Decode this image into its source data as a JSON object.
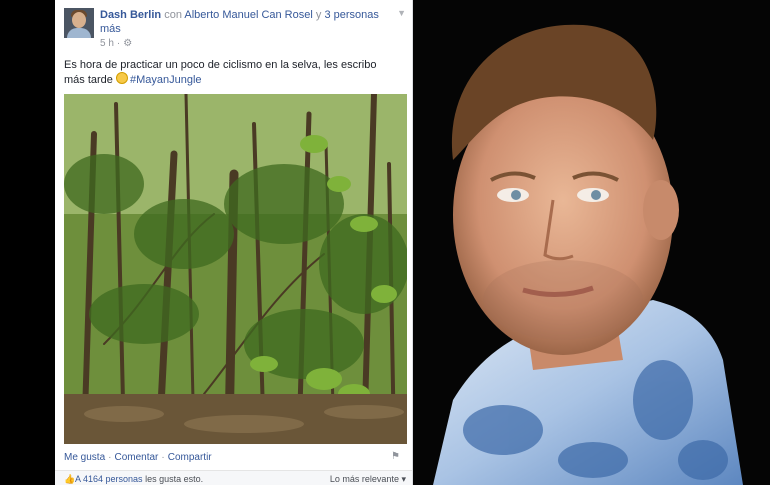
{
  "post": {
    "author": "Dash Berlin",
    "with_word": "con",
    "tagged_person": "Alberto Manuel Can Rosel",
    "and_word": "y",
    "others": "3 personas",
    "others_more": "más",
    "time": "5 h",
    "privacy_icon": "gear-icon",
    "text": "Es hora de practicar un poco de ciclismo en la selva, les escribo más tarde",
    "hashtag": "#MayanJungle",
    "photo_alt": "jungle-photo"
  },
  "actions": {
    "like": "Me gusta",
    "comment": "Comentar",
    "share": "Compartir"
  },
  "footer": {
    "likes_count": "A 4164 personas",
    "likes_suffix": "les gusta esto.",
    "sort_label": "Lo más relevante",
    "sort_caret": "▾"
  },
  "colors": {
    "link": "#365899",
    "meta": "#90949c",
    "text": "#1d2129"
  }
}
